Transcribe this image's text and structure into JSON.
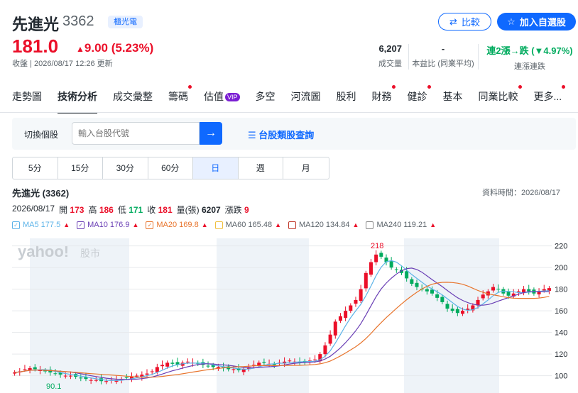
{
  "header": {
    "name": "先進光",
    "code": "3362",
    "tag": "櫃光電",
    "compare_label": "比較",
    "watchlist_label": "加入自選股",
    "price": "181.0",
    "change": "9.00 (5.23%)",
    "meta": "收盤 | 2026/08/17 12:26 更新"
  },
  "stats": {
    "volume": {
      "value": "6,207",
      "label": "成交量"
    },
    "pe": {
      "value": "-",
      "label": "本益比 (同業平均)"
    },
    "streak": {
      "value": "連2漲→跌 (▼4.97%)",
      "label": "連漲連跌"
    }
  },
  "tabs": [
    {
      "label": "走勢圖",
      "dot": false
    },
    {
      "label": "技術分析",
      "dot": false
    },
    {
      "label": "成交彙整",
      "dot": false
    },
    {
      "label": "籌碼",
      "dot": true
    },
    {
      "label": "估值",
      "dot": false
    },
    {
      "label": "多空",
      "dot": false
    },
    {
      "label": "河流圖",
      "dot": false
    },
    {
      "label": "股利",
      "dot": false
    },
    {
      "label": "財務",
      "dot": true
    },
    {
      "label": "健診",
      "dot": true
    },
    {
      "label": "基本",
      "dot": false
    },
    {
      "label": "同業比較",
      "dot": true
    },
    {
      "label": "更多...",
      "dot": true
    }
  ],
  "vip_badge": "VIP",
  "search": {
    "label": "切換個股",
    "placeholder": "輸入台股代號",
    "category_link": "台股類股查詢"
  },
  "periods": [
    "5分",
    "15分",
    "30分",
    "60分",
    "日",
    "週",
    "月"
  ],
  "active_period": "日",
  "chart_title": "先進光 (3362)",
  "data_time": "資料時間：2026/08/17",
  "ohlc": {
    "date": "2026/08/17",
    "open_label": "開",
    "open": "173",
    "high_label": "高",
    "high": "186",
    "low_label": "低",
    "low": "171",
    "close_label": "收",
    "close": "181",
    "volume_label": "量(張)",
    "volume": "6207",
    "change_label": "漲跌",
    "change": "9"
  },
  "moving_averages": [
    {
      "label": "MA5 177.5",
      "color": "#5cb3e8"
    },
    {
      "label": "MA10 176.9",
      "color": "#6a3fb5"
    },
    {
      "label": "MA20 169.8",
      "color": "#e8742c"
    },
    {
      "label": "MA60 165.48",
      "color": "#f0c040"
    },
    {
      "label": "MA120 134.84",
      "color": "#c0392b"
    },
    {
      "label": "MA240 119.21",
      "color": "#888888"
    }
  ],
  "watermark": "yahoo!股市",
  "chart_data": {
    "type": "candlestick",
    "y_ticks": [
      100,
      120,
      140,
      160,
      180,
      200,
      220
    ],
    "ylim": [
      84,
      227
    ],
    "annotations": {
      "max": "218",
      "min": "90.1"
    },
    "closes": [
      103,
      104,
      106,
      107,
      106,
      105,
      104,
      103,
      102,
      101,
      100,
      100,
      99,
      98,
      97,
      96,
      96,
      95,
      95,
      96,
      96,
      97,
      98,
      99,
      100,
      101,
      102,
      104,
      108,
      110,
      112,
      111,
      110,
      112,
      113,
      112,
      111,
      110,
      109,
      108,
      108,
      107,
      106,
      106,
      105,
      106,
      108,
      110,
      112,
      112,
      111,
      110,
      112,
      113,
      114,
      113,
      112,
      113,
      114,
      115,
      120,
      128,
      138,
      150,
      155,
      160,
      165,
      170,
      180,
      195,
      205,
      212,
      210,
      205,
      200,
      198,
      195,
      190,
      185,
      182,
      180,
      178,
      176,
      172,
      168,
      162,
      160,
      158,
      160,
      162,
      165,
      170,
      175,
      178,
      182,
      180,
      176,
      174,
      176,
      178,
      180,
      178,
      176,
      178,
      180,
      181
    ]
  }
}
